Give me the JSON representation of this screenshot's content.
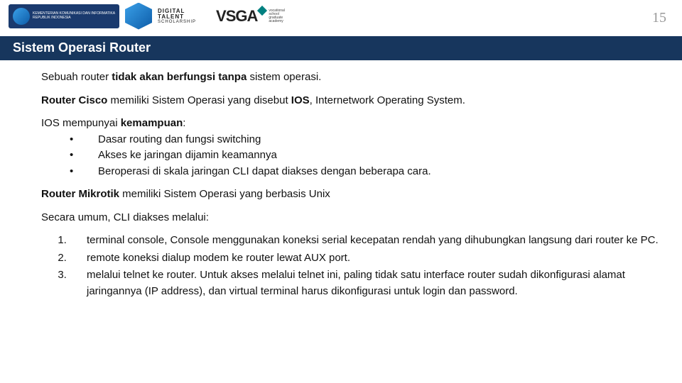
{
  "page_number": "15",
  "logos": {
    "kominfo_line1": "KEMENTERIAN KOMUNIKASI DAN INFORMATIKA",
    "kominfo_line2": "REPUBLIK INDONESIA",
    "dts_line1": "DIGITAL",
    "dts_line2": "TALENT",
    "dts_line3": "SCHOLARSHIP",
    "vsga_text": "VSGA",
    "vsga_sub1": "vocational",
    "vsga_sub2": "school",
    "vsga_sub3": "graduate",
    "vsga_sub4": "academy"
  },
  "title": "Sistem Operasi Router",
  "p1_a": "Sebuah router  ",
  "p1_b": "tidak akan berfungsi tanpa",
  "p1_c": " sistem operasi.",
  "p2_a": "Router Cisco",
  "p2_b": " memiliki Sistem Operasi yang disebut ",
  "p2_c": "IOS",
  "p2_d": ", Internetwork Operating System.",
  "p3_a": "IOS  mempunyai ",
  "p3_b": "kemampuan",
  "p3_c": ":",
  "bul1": "Dasar routing dan fungsi switching",
  "bul2": "Akses ke jaringan dijamin keamannya",
  "bul3": "Beroperasi di skala jaringan CLI dapat diakses dengan beberapa cara.",
  "p4_a": "Router Mikrotik",
  "p4_b": " memiliki Sistem Operasi yang berbasis Unix",
  "p5": "Secara umum, CLI diakses melalui:",
  "ol1": "terminal console, Console menggunakan koneksi serial kecepatan rendah yang dihubungkan langsung dari router ke PC.",
  "ol2": "remote koneksi dialup modem ke router lewat AUX port.",
  "ol3": "melalui telnet ke router. Untuk akses melalui telnet ini, paling tidak satu interface router sudah dikonfigurasi alamat jaringannya (IP address), dan virtual terminal harus dikonfigurasi untuk login dan password."
}
